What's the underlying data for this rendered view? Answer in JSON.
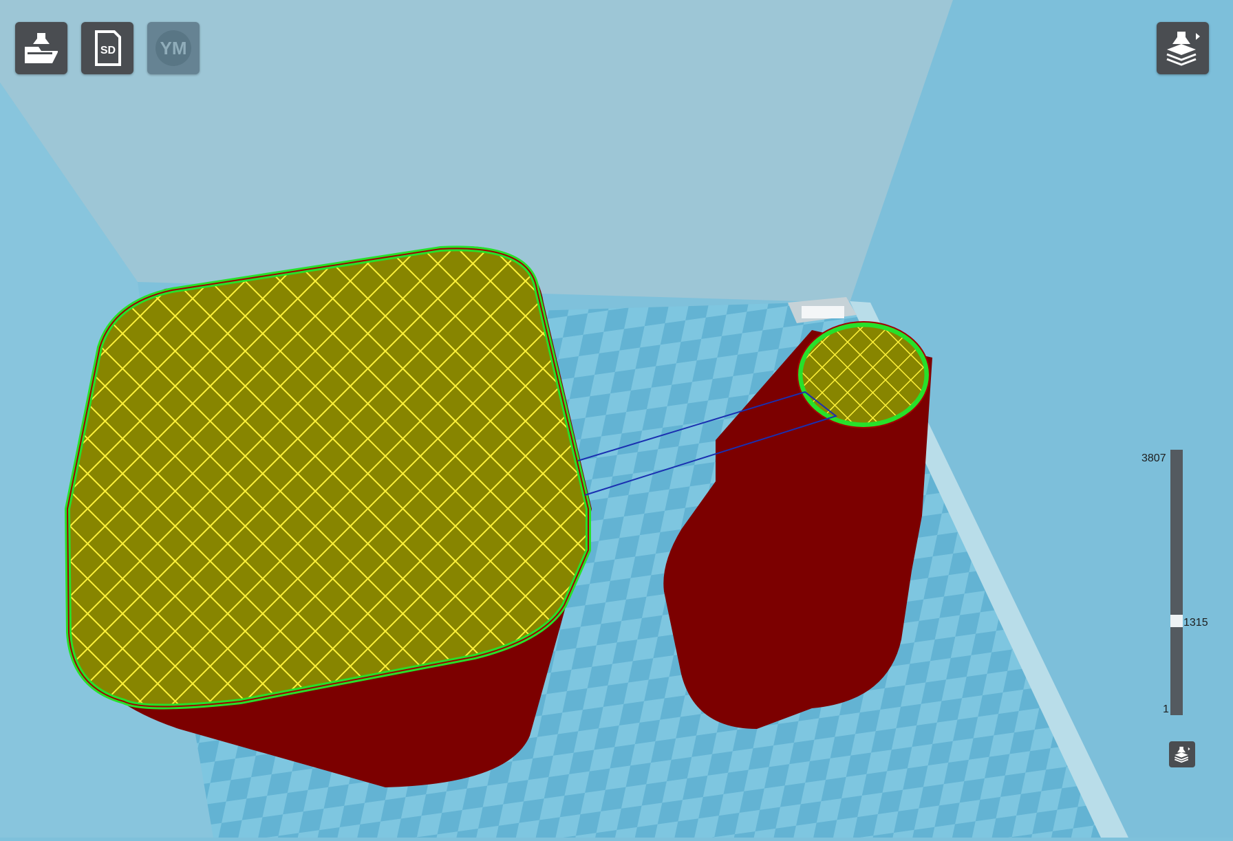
{
  "toolbar": {
    "buttons": [
      {
        "id": "load",
        "icon": "load-model-icon",
        "label": ""
      },
      {
        "id": "sd",
        "icon": "sd-card-icon",
        "label": "SD"
      },
      {
        "id": "youmagine",
        "icon": "youmagine-icon",
        "label": "YM"
      }
    ]
  },
  "view_mode": {
    "icon": "layer-view-icon"
  },
  "layer_slider": {
    "max": "3807",
    "current": "1315",
    "min": "1",
    "current_fraction": 0.345
  },
  "colors": {
    "background": "#7fc1db",
    "infill": "#d8d200",
    "outer_wall": "#8a0000",
    "inner_wall": "#27e02a",
    "travel": "#1a2fb0",
    "toolbar_button": "#4a4d51"
  }
}
